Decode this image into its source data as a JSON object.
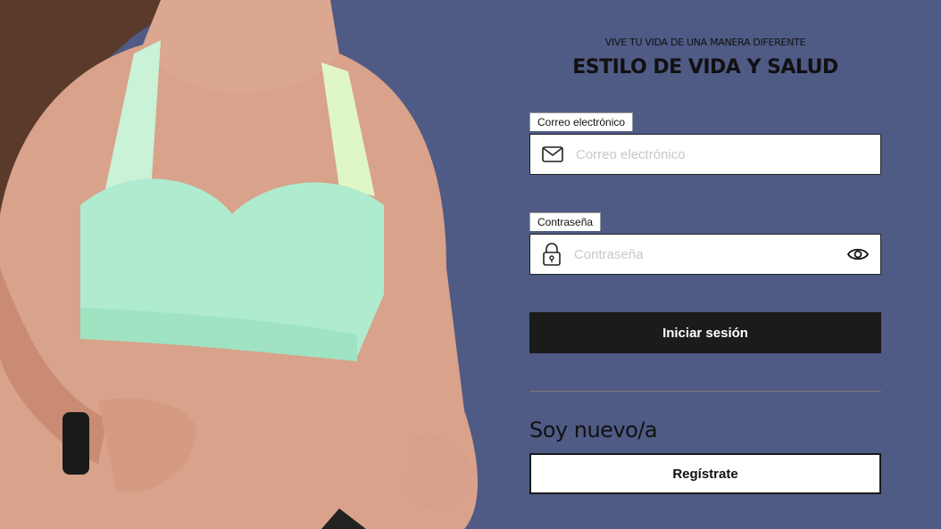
{
  "header": {
    "subtitle": "VIVE TU VIDA DE UNA MANERA DIFERENTE",
    "title": "ESTILO DE VIDA Y SALUD"
  },
  "email": {
    "label": "Correo electrónico",
    "placeholder": "Correo electrónico",
    "icon": "envelope-icon"
  },
  "password": {
    "label": "Contraseña",
    "placeholder": "Contraseña",
    "icon": "lock-icon",
    "toggle_icon": "eye-icon"
  },
  "login_button": "Iniciar sesión",
  "new_user": {
    "heading": "Soy nuevo/a",
    "register_button": "Regístrate"
  },
  "colors": {
    "background": "#4f5a85",
    "primary_button": "#1b1b1b"
  }
}
